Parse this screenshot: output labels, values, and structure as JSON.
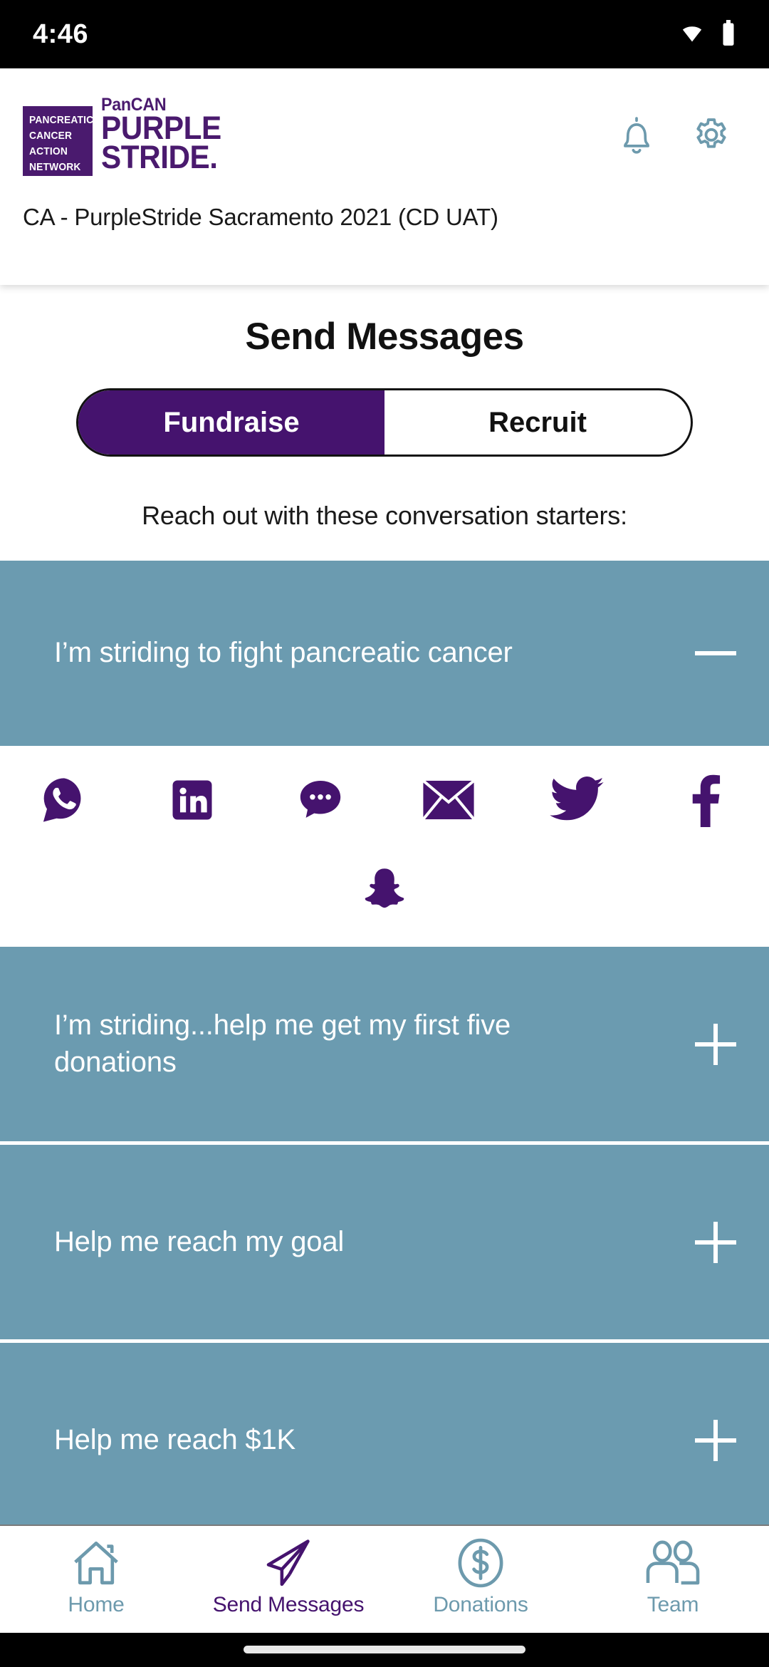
{
  "status_bar": {
    "time": "4:46",
    "icons": [
      "wifi-icon",
      "battery-icon"
    ]
  },
  "header": {
    "logo": {
      "box_lines": [
        "PANCREATIC",
        "CANCER",
        "ACTION",
        "NETWORK"
      ],
      "wordmark_line1": "PanCAN",
      "wordmark_line2": "PURPLE",
      "wordmark_line3": "STRIDE."
    },
    "notifications_icon": "bell-icon",
    "settings_icon": "gear-icon",
    "event_name": "CA - PurpleStride Sacramento 2021 (CD UAT)"
  },
  "main": {
    "page_title": "Send Messages",
    "tabs": [
      {
        "label": "Fundraise",
        "active": true
      },
      {
        "label": "Recruit",
        "active": false
      }
    ],
    "starters_prompt": "Reach out with these conversation starters:",
    "cards": [
      {
        "label": "I’m striding to fight pancreatic cancer",
        "expanded": true,
        "toggle": "minus-icon"
      },
      {
        "label": "I’m striding...help me get my first five donations",
        "expanded": false,
        "toggle": "plus-icon"
      },
      {
        "label": "Help me reach my goal",
        "expanded": false,
        "toggle": "plus-icon"
      },
      {
        "label": "Help me reach $1K",
        "expanded": false,
        "toggle": "plus-icon"
      }
    ],
    "share_options": [
      {
        "name": "whatsapp-icon",
        "label": "WhatsApp"
      },
      {
        "name": "linkedin-icon",
        "label": "LinkedIn"
      },
      {
        "name": "sms-icon",
        "label": "Text Message"
      },
      {
        "name": "email-icon",
        "label": "Email"
      },
      {
        "name": "twitter-icon",
        "label": "Twitter"
      },
      {
        "name": "facebook-icon",
        "label": "Facebook"
      },
      {
        "name": "snapchat-icon",
        "label": "Snapchat"
      }
    ]
  },
  "bottom_nav": [
    {
      "label": "Home",
      "icon": "home-icon",
      "active": false
    },
    {
      "label": "Send Messages",
      "icon": "paper-plane-icon",
      "active": true
    },
    {
      "label": "Donations",
      "icon": "dollar-circle-icon",
      "active": false
    },
    {
      "label": "Team",
      "icon": "people-icon",
      "active": false
    }
  ],
  "colors": {
    "brand_purple": "#45136e",
    "card_teal": "#6b9bb0",
    "nav_inactive": "#6d9aad",
    "status_bar": "#000000"
  }
}
